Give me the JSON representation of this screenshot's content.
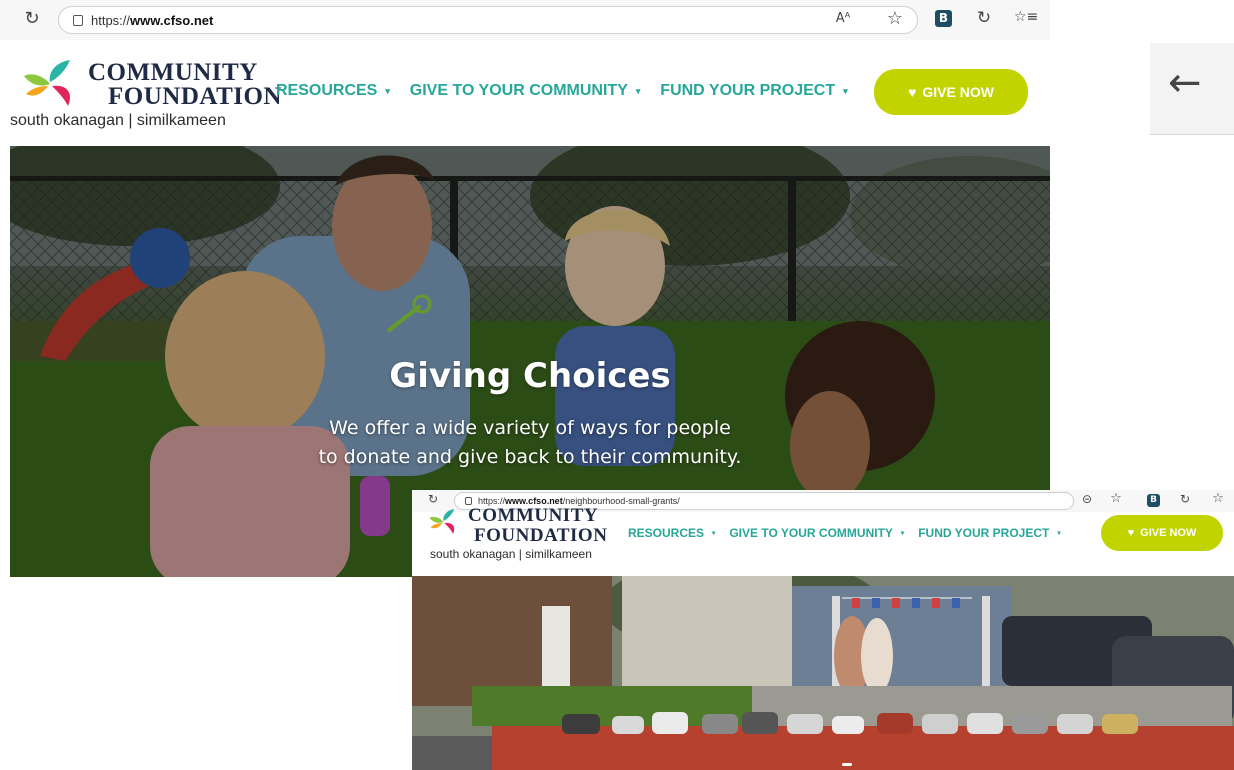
{
  "screen1": {
    "browser": {
      "url_prefix": "https://",
      "url_domain": "www.cfso.net",
      "url_path": "",
      "reader_icon": "Aᴬ",
      "favorite_icon": "☆",
      "extension_label": "B",
      "collections_icon": "↻",
      "favorites_bar_icon": "☆≡"
    },
    "header": {
      "logo_line1": "COMMUNITY",
      "logo_line2": "FOUNDATION",
      "logo_sub": "south okanagan | similkameen",
      "nav": [
        {
          "label": "RESOURCES"
        },
        {
          "label": "GIVE TO YOUR COMMUNITY"
        },
        {
          "label": "FUND YOUR PROJECT"
        }
      ],
      "caret": "▾",
      "give_label": "GIVE NOW",
      "heart": "♥"
    },
    "hero": {
      "title": "Giving Choices",
      "subtitle_line1": "We offer a wide variety of ways for people",
      "subtitle_line2": "to donate and give back to their community."
    }
  },
  "back_panel": {
    "arrow": "←"
  },
  "screen2": {
    "browser": {
      "url_prefix": "https://",
      "url_domain": "www.cfso.net",
      "url_path": "/neighbourhood-small-grants/",
      "reader_icon": "⊝",
      "favorite_icon": "☆",
      "extension_label": "B",
      "collections_icon": "↻",
      "favorites_bar_icon": "☆"
    },
    "header": {
      "logo_line1": "COMMUNITY",
      "logo_line2": "FOUNDATION",
      "logo_sub": "south okanagan | similkameen",
      "nav": [
        {
          "label": "RESOURCES"
        },
        {
          "label": "GIVE TO YOUR COMMUNITY"
        },
        {
          "label": "FUND YOUR PROJECT"
        }
      ],
      "caret": "▾",
      "give_label": "GIVE NOW",
      "heart": "♥"
    }
  },
  "colors": {
    "brand_teal": "#27a69a",
    "give_button": "#c2d400",
    "logo_navy": "#1f2a44",
    "logo_green": "#8dc63f",
    "logo_teal": "#2bb3a6",
    "logo_red": "#e0245e",
    "logo_orange": "#f3a41b"
  }
}
